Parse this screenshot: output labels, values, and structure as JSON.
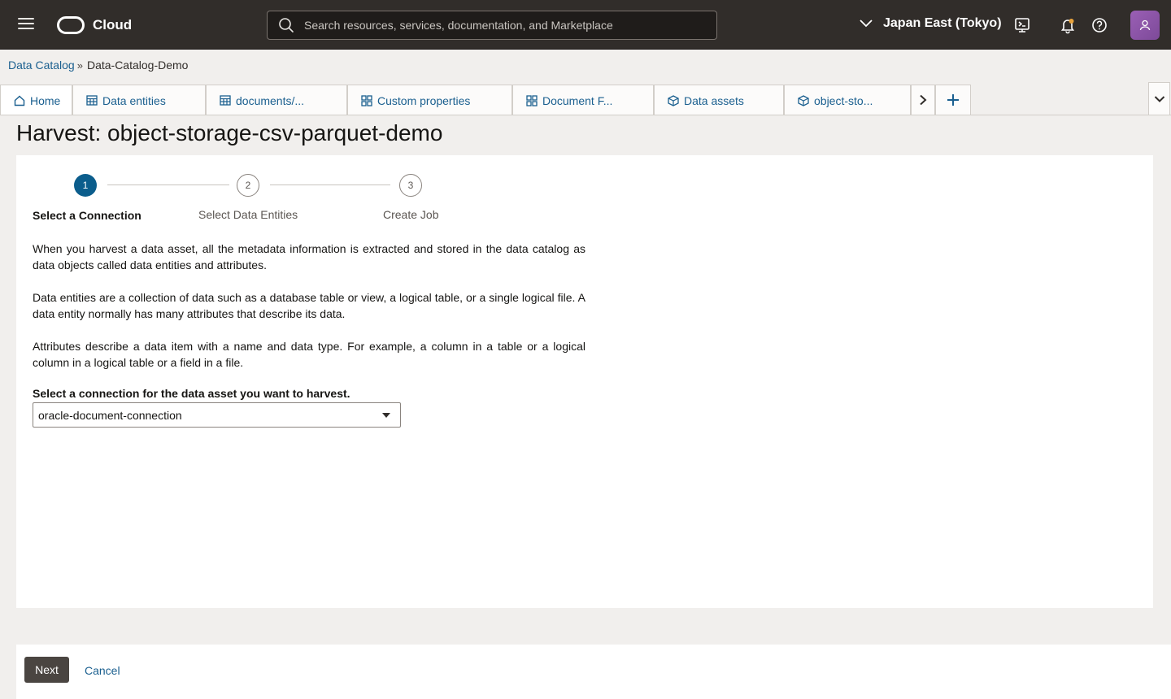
{
  "header": {
    "brand": "Cloud",
    "search_placeholder": "Search resources, services, documentation, and Marketplace",
    "region": "Japan East (Tokyo)"
  },
  "breadcrumb": {
    "parent": "Data Catalog",
    "separator": "»",
    "current": "Data-Catalog-Demo"
  },
  "tabs": {
    "home": "Home",
    "data_entities": "Data entities",
    "documents": "documents/...",
    "custom_properties": "Custom properties",
    "document_f": "Document F...",
    "data_assets": "Data assets",
    "object_sto": "object-sto..."
  },
  "page": {
    "title": "Harvest: object-storage-csv-parquet-demo"
  },
  "steps": [
    {
      "number": "1",
      "label": "Select a Connection"
    },
    {
      "number": "2",
      "label": "Select Data Entities"
    },
    {
      "number": "3",
      "label": "Create Job"
    }
  ],
  "content": {
    "para1": "When you harvest a data asset, all the metadata information is extracted and stored in the data catalog as data objects called data entities and attributes.",
    "para2": "Data entities are a collection of data such as a database table or view, a logical table, or a single logical file. A data entity normally has many attributes that describe its data.",
    "para3": "Attributes describe a data item with a name and data type. For example, a column in a table or a logical column in a logical table or a field in a file.",
    "connection_label": "Select a connection for the data asset you want to harvest.",
    "connection_value": "oracle-document-connection"
  },
  "footer": {
    "next": "Next",
    "cancel": "Cancel"
  },
  "colors": {
    "header_bg": "#312d2a",
    "accent": "#0b5d8c",
    "link": "#1a5f8f",
    "button": "#4a4541"
  }
}
